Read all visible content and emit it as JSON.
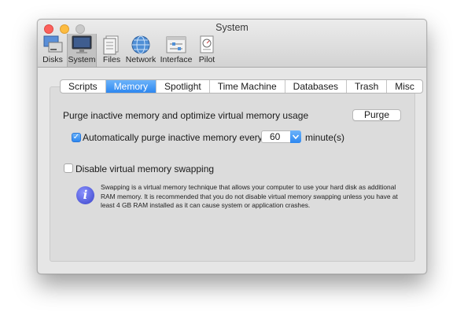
{
  "window": {
    "title": "System"
  },
  "toolbar": {
    "items": [
      {
        "label": "Disks",
        "icon": "disks-icon"
      },
      {
        "label": "System",
        "icon": "monitor-icon",
        "selected": true
      },
      {
        "label": "Files",
        "icon": "files-icon"
      },
      {
        "label": "Network",
        "icon": "globe-icon"
      },
      {
        "label": "Interface",
        "icon": "interface-icon"
      },
      {
        "label": "Pilot",
        "icon": "pilot-icon"
      }
    ]
  },
  "tabs": [
    {
      "label": "Scripts"
    },
    {
      "label": "Memory",
      "active": true
    },
    {
      "label": "Spotlight"
    },
    {
      "label": "Time Machine"
    },
    {
      "label": "Databases"
    },
    {
      "label": "Trash"
    },
    {
      "label": "Misc"
    }
  ],
  "memory": {
    "purge_heading": "Purge inactive memory and optimize virtual memory usage",
    "purge_button": "Purge",
    "auto_purge": {
      "checked": true,
      "label": "Automatically purge inactive memory every",
      "value": "60",
      "unit": "minute(s)"
    },
    "disable_swap": {
      "checked": false,
      "label": "Disable virtual memory swapping"
    },
    "info_text": "Swapping is a virtual memory technique that allows your computer to use your hard disk as additional RAM memory. It is recommended that you do not disable virtual memory swapping unless you have at least 4 GB RAM installed as it can cause system or application crashes."
  },
  "colors": {
    "accent": "#2d87f0",
    "info": "#3a43c8"
  }
}
